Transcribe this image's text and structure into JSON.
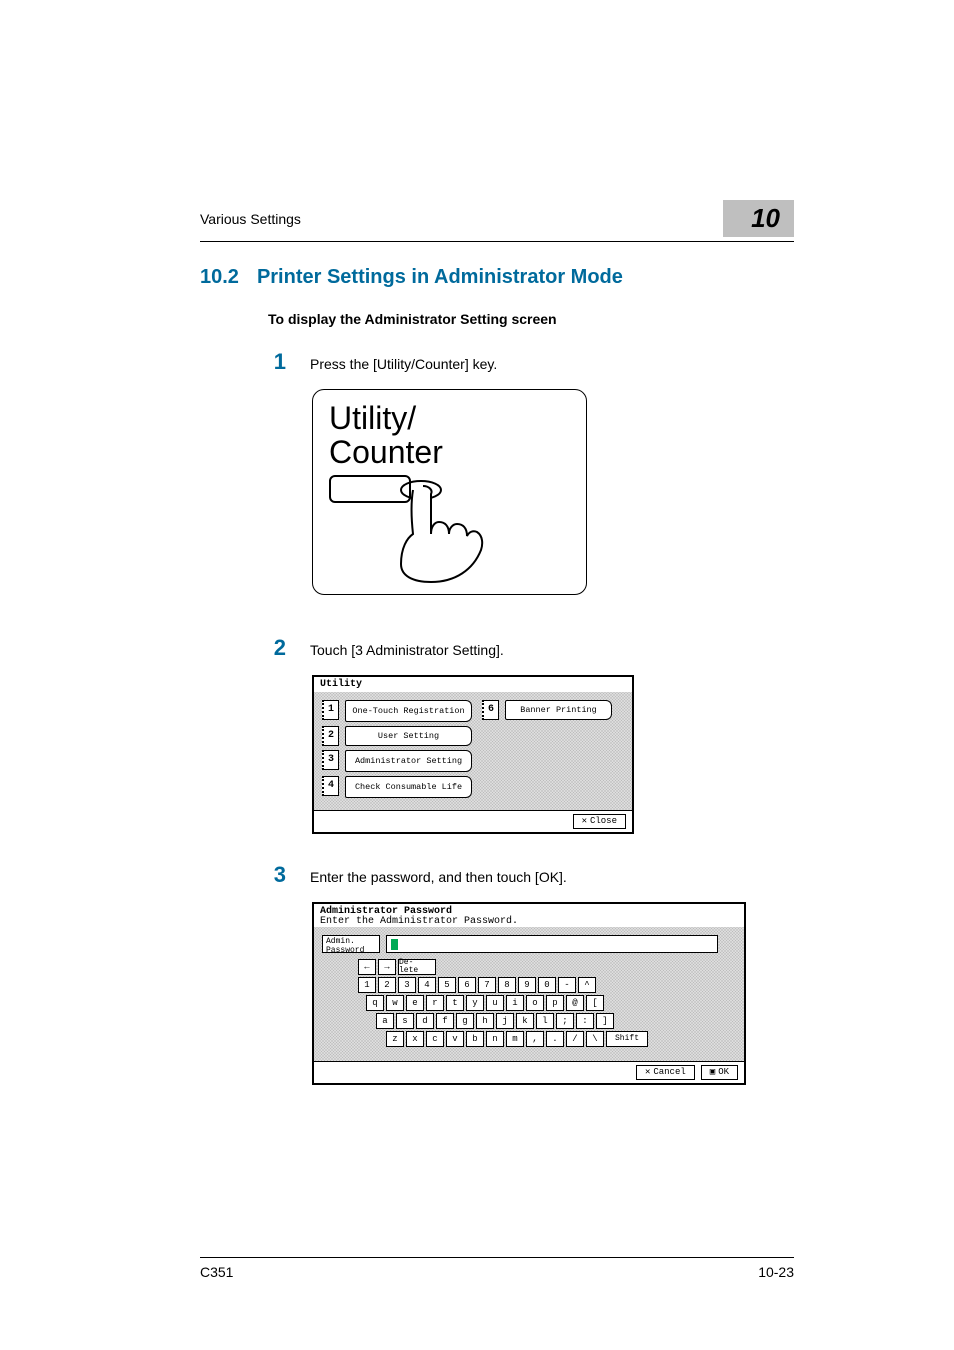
{
  "header": {
    "section_name": "Various Settings",
    "chapter_number": "10"
  },
  "section": {
    "number": "10.2",
    "title": "Printer Settings in Administrator Mode"
  },
  "subheading": "To display the Administrator Setting screen",
  "steps": {
    "s1": {
      "num": "1",
      "text": "Press the [Utility/Counter] key."
    },
    "s2": {
      "num": "2",
      "text": "Touch [3 Administrator Setting]."
    },
    "s3": {
      "num": "3",
      "text": "Enter the password, and then touch [OK]."
    }
  },
  "figure1": {
    "label_line1": "Utility/",
    "label_line2": "Counter"
  },
  "panel_utility": {
    "title": "Utility",
    "items_left": [
      {
        "num": "1",
        "label": "One-Touch Registration"
      },
      {
        "num": "2",
        "label": "User Setting"
      },
      {
        "num": "3",
        "label": "Administrator Setting"
      },
      {
        "num": "4",
        "label": "Check Consumable Life"
      }
    ],
    "items_right": [
      {
        "num": "6",
        "label": "Banner Printing"
      }
    ],
    "close_btn": "Close"
  },
  "panel_password": {
    "title": "Administrator Password",
    "subtitle": "Enter the Administrator Password.",
    "field_label": "Admin. Password",
    "nav_left": "←",
    "nav_right": "→",
    "delete_btn": "De- lete",
    "row_num": [
      "1",
      "2",
      "3",
      "4",
      "5",
      "6",
      "7",
      "8",
      "9",
      "0",
      "-",
      "^"
    ],
    "row_q": [
      "q",
      "w",
      "e",
      "r",
      "t",
      "y",
      "u",
      "i",
      "o",
      "p",
      "@",
      "["
    ],
    "row_a": [
      "a",
      "s",
      "d",
      "f",
      "g",
      "h",
      "j",
      "k",
      "l",
      ";",
      ":",
      "]"
    ],
    "row_z": [
      "z",
      "x",
      "c",
      "v",
      "b",
      "n",
      "m",
      ",",
      ".",
      "/",
      "\\"
    ],
    "shift_btn": "Shift",
    "cancel_btn": "Cancel",
    "ok_btn": "OK"
  },
  "footer": {
    "model": "C351",
    "page_number": "10-23"
  }
}
